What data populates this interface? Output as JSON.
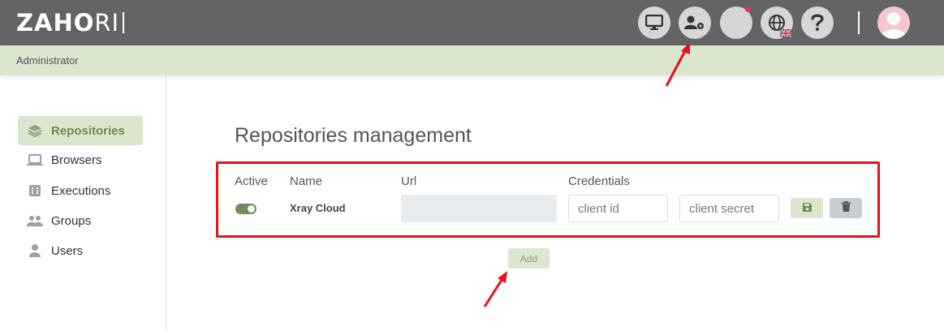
{
  "header": {
    "logo_left": "ZAHO",
    "logo_right": "RI",
    "icons": [
      "desktop-icon",
      "user-settings-icon",
      "notifications-icon",
      "language-icon",
      "help-icon",
      "user-avatar"
    ]
  },
  "breadcrumb": {
    "label": "Administrator"
  },
  "sidebar": {
    "items": [
      {
        "label": "Repositories",
        "icon": "layers-icon",
        "active": true
      },
      {
        "label": "Browsers",
        "icon": "laptop-icon",
        "active": false
      },
      {
        "label": "Executions",
        "icon": "executions-icon",
        "active": false
      },
      {
        "label": "Groups",
        "icon": "users-icon",
        "active": false
      },
      {
        "label": "Users",
        "icon": "user-icon",
        "active": false
      }
    ]
  },
  "main": {
    "title": "Repositories management",
    "table": {
      "headers": {
        "active": "Active",
        "name": "Name",
        "url": "Url",
        "credentials": "Credentials"
      },
      "row": {
        "active": true,
        "name": "Xray Cloud",
        "url": "",
        "client_id_placeholder": "client id",
        "client_secret_placeholder": "client secret"
      }
    },
    "add_label": "Add"
  },
  "colors": {
    "topbar": "#646464",
    "accent_light": "#dbe6cf",
    "accent_dark": "#6e8a55",
    "toggle": "#738a5c",
    "highlight": "#e8101c"
  }
}
